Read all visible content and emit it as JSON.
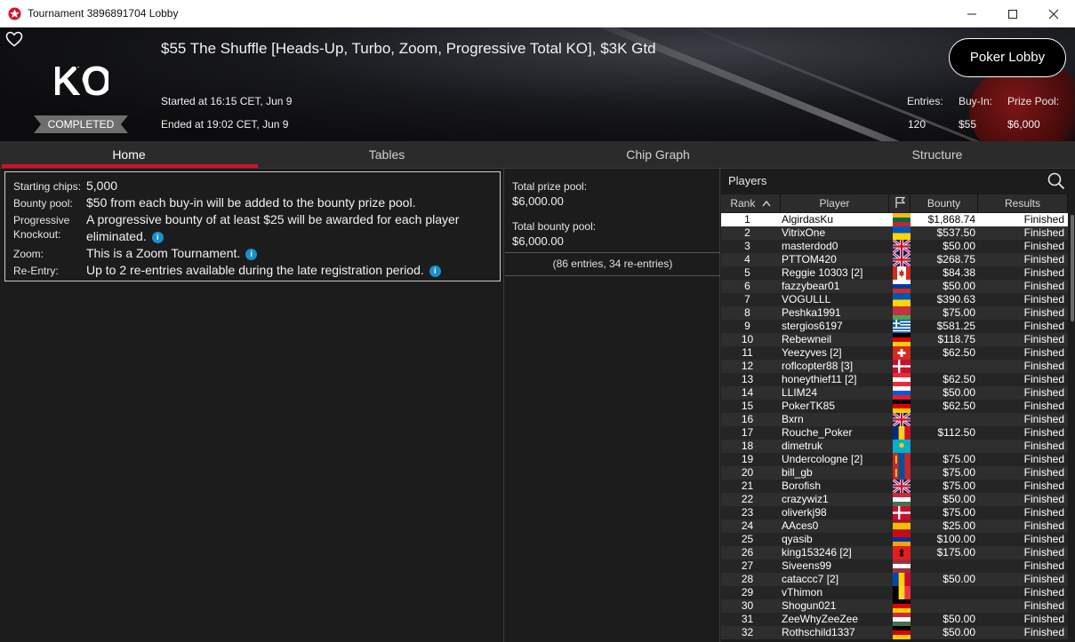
{
  "window": {
    "title": "Tournament 3896891704 Lobby"
  },
  "header": {
    "logo_text": "KO",
    "status": "COMPLETED",
    "tournament_name": "$55 The Shuffle [Heads-Up, Turbo, Zoom, Progressive Total KO], $3K Gtd",
    "started": "Started at 16:15 CET, Jun 9",
    "ended": "Ended at 19:02 CET, Jun 9",
    "lobby_button": "Poker Lobby",
    "stats": [
      {
        "label": "Entries:",
        "value": "120"
      },
      {
        "label": "Buy-In:",
        "value": "$55"
      },
      {
        "label": "Prize Pool:",
        "value": "$6,000"
      }
    ]
  },
  "tabs": [
    "Home",
    "Tables",
    "Chip Graph",
    "Structure"
  ],
  "home": {
    "items": [
      {
        "label": "Starting chips:",
        "value": "5,000"
      },
      {
        "label": "Bounty pool:",
        "value": "$50 from each buy-in will be added to the bounty prize pool."
      },
      {
        "label": "Progressive",
        "label2": "Knockout:",
        "value": "A progressive bounty of at least $25 will be awarded for each player",
        "value2": "eliminated."
      },
      {
        "label": "Zoom:",
        "value": "This is a Zoom Tournament."
      },
      {
        "label": "Re-Entry:",
        "value": "Up to 2 re-entries available during the late registration period."
      }
    ]
  },
  "pools": {
    "prize_label": "Total prize pool:",
    "prize_value": "$6,000.00",
    "bounty_label": "Total bounty pool:",
    "bounty_value": "$6,000.00",
    "entries_note": "(86 entries, 34 re-entries)"
  },
  "players": {
    "title": "Players",
    "columns": [
      "Rank",
      "Player",
      "Bounty",
      "Results"
    ],
    "rows": [
      {
        "rank": "1",
        "player": "AlgirdasKu",
        "flag": "lt",
        "bounty": "$1,868.74",
        "result": "Finished"
      },
      {
        "rank": "2",
        "player": "VitrixOne",
        "flag": "ua",
        "bounty": "$537.50",
        "result": "Finished"
      },
      {
        "rank": "3",
        "player": "masterdod0",
        "flag": "gb",
        "bounty": "$50.00",
        "result": "Finished"
      },
      {
        "rank": "4",
        "player": "PTTOM420",
        "flag": "gb",
        "bounty": "$268.75",
        "result": "Finished"
      },
      {
        "rank": "5",
        "player": "Reggie 10303 [2]",
        "flag": "ca",
        "bounty": "$84.38",
        "result": "Finished"
      },
      {
        "rank": "6",
        "player": "fazzybear01",
        "flag": "ru",
        "bounty": "$50.00",
        "result": "Finished"
      },
      {
        "rank": "7",
        "player": "VOGULLL",
        "flag": "ua",
        "bounty": "$390.63",
        "result": "Finished"
      },
      {
        "rank": "8",
        "player": "Peshka1991",
        "flag": "by",
        "bounty": "$75.00",
        "result": "Finished"
      },
      {
        "rank": "9",
        "player": "stergios6197",
        "flag": "gr",
        "bounty": "$581.25",
        "result": "Finished"
      },
      {
        "rank": "10",
        "player": "Rebewneil",
        "flag": "de",
        "bounty": "$118.75",
        "result": "Finished"
      },
      {
        "rank": "11",
        "player": "Yeezyves [2]",
        "flag": "ch",
        "bounty": "$62.50",
        "result": "Finished"
      },
      {
        "rank": "12",
        "player": "roflcopter88 [3]",
        "flag": "dk",
        "bounty": "",
        "result": "Finished"
      },
      {
        "rank": "13",
        "player": "honeythief11 [2]",
        "flag": "at",
        "bounty": "$62.50",
        "result": "Finished"
      },
      {
        "rank": "14",
        "player": "LLIM24",
        "flag": "si",
        "bounty": "$50.00",
        "result": "Finished"
      },
      {
        "rank": "15",
        "player": "PokerTK85",
        "flag": "de",
        "bounty": "$62.50",
        "result": "Finished"
      },
      {
        "rank": "16",
        "player": "Bxrn",
        "flag": "gb",
        "bounty": "",
        "result": "Finished"
      },
      {
        "rank": "17",
        "player": "Rouche_Poker",
        "flag": "ro",
        "bounty": "$112.50",
        "result": "Finished"
      },
      {
        "rank": "18",
        "player": "dimetruk",
        "flag": "kz",
        "bounty": "",
        "result": "Finished"
      },
      {
        "rank": "19",
        "player": "Undercologne [2]",
        "flag": "mn",
        "bounty": "$75.00",
        "result": "Finished"
      },
      {
        "rank": "20",
        "player": "bill_gb",
        "flag": "mn",
        "bounty": "$75.00",
        "result": "Finished"
      },
      {
        "rank": "21",
        "player": "Borofish",
        "flag": "gb",
        "bounty": "$75.00",
        "result": "Finished"
      },
      {
        "rank": "22",
        "player": "crazywiz1",
        "flag": "hu",
        "bounty": "$50.00",
        "result": "Finished"
      },
      {
        "rank": "23",
        "player": "oliverkj98",
        "flag": "dk",
        "bounty": "$75.00",
        "result": "Finished"
      },
      {
        "rank": "24",
        "player": "AAces0",
        "flag": "es",
        "bounty": "$25.00",
        "result": "Finished"
      },
      {
        "rank": "25",
        "player": "qyasib",
        "flag": "am",
        "bounty": "$100.00",
        "result": "Finished"
      },
      {
        "rank": "26",
        "player": "king153246 [2]",
        "flag": "al",
        "bounty": "$175.00",
        "result": "Finished"
      },
      {
        "rank": "27",
        "player": "Siveens99",
        "flag": "lv",
        "bounty": "",
        "result": "Finished"
      },
      {
        "rank": "28",
        "player": "cataccc7 [2]",
        "flag": "md",
        "bounty": "$50.00",
        "result": "Finished"
      },
      {
        "rank": "29",
        "player": "vThimon",
        "flag": "be",
        "bounty": "",
        "result": "Finished"
      },
      {
        "rank": "30",
        "player": "Shogun021",
        "flag": "de",
        "bounty": "",
        "result": "Finished"
      },
      {
        "rank": "31",
        "player": "ZeeWhyZeeZee",
        "flag": "hu",
        "bounty": "$50.00",
        "result": "Finished"
      },
      {
        "rank": "32",
        "player": "Rothschild1337",
        "flag": "de",
        "bounty": "$50.00",
        "result": "Finished"
      }
    ]
  },
  "colors": {
    "accent": "#d6102a",
    "info": "#1a8fd0"
  }
}
